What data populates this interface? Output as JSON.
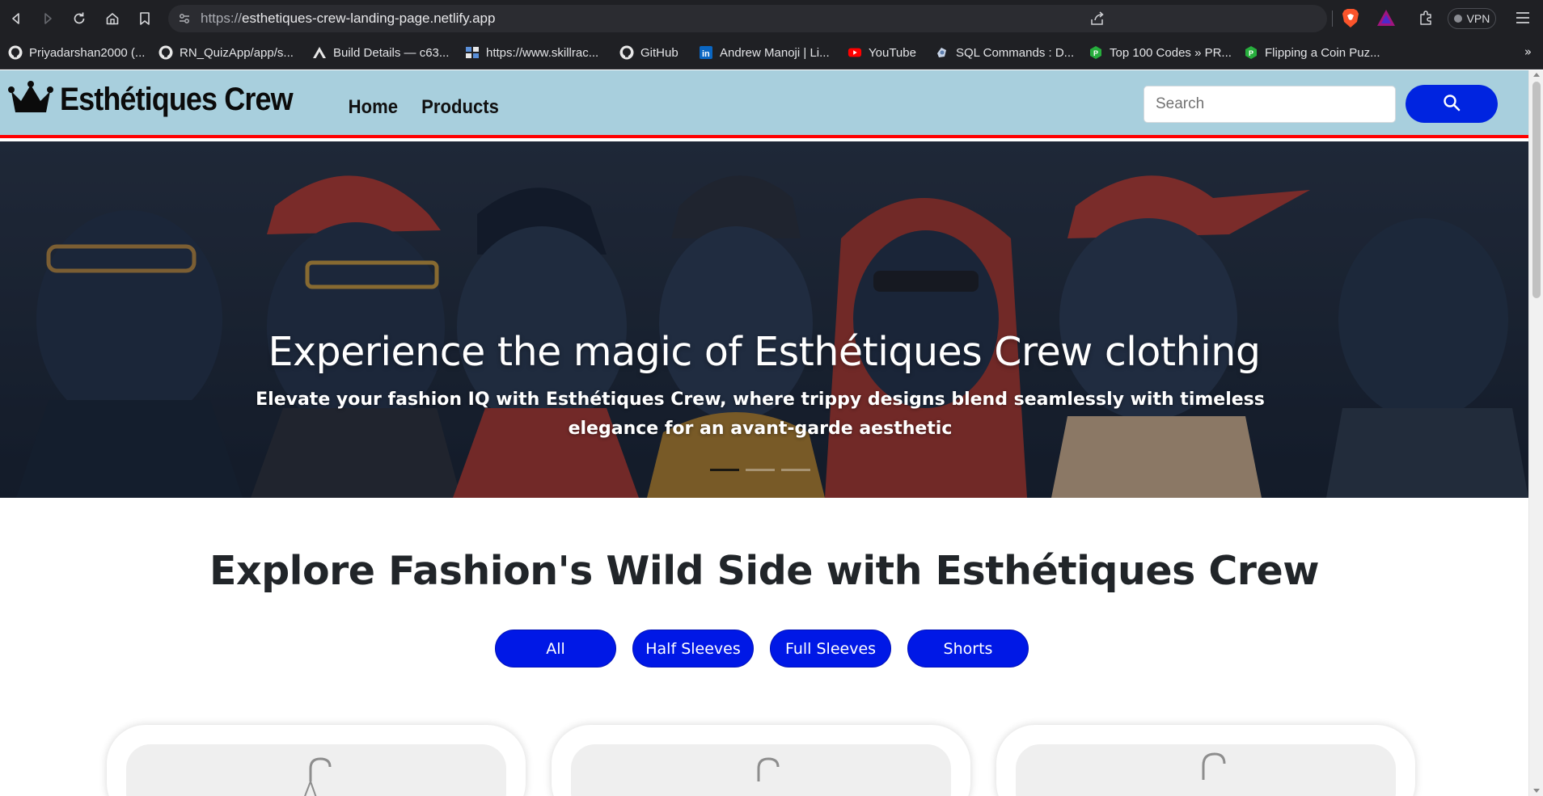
{
  "browser": {
    "url_scheme": "https://",
    "url_host": "esthetiques-crew-landing-page.netlify.app",
    "vpn_label": "VPN",
    "bookmarks": [
      {
        "label": "Priyadarshan2000 (...",
        "icon": "github-icon"
      },
      {
        "label": "RN_QuizApp/app/s...",
        "icon": "github-icon"
      },
      {
        "label": "Build Details — c63...",
        "icon": "expo-icon"
      },
      {
        "label": "https://www.skillrac...",
        "icon": "skillrack-icon"
      },
      {
        "label": "GitHub",
        "icon": "github-icon"
      },
      {
        "label": "Andrew Manoji | Li...",
        "icon": "linkedin-icon"
      },
      {
        "label": "YouTube",
        "icon": "youtube-icon"
      },
      {
        "label": "SQL Commands : D...",
        "icon": "sql-icon"
      },
      {
        "label": "Top 100 Codes » PR...",
        "icon": "prepinsta-icon"
      },
      {
        "label": "Flipping a Coin Puz...",
        "icon": "prepinsta-icon"
      }
    ],
    "more_bookmarks": "»"
  },
  "site": {
    "brand": "Esthétiques Crew",
    "nav": [
      "Home",
      "Products"
    ],
    "search_placeholder": "Search",
    "colors": {
      "header_bg": "#a8cfdd",
      "header_border": "#ff0000",
      "primary_button": "#0018e6"
    }
  },
  "hero": {
    "title": "Experience the magic of Esthétiques Crew clothing",
    "subtitle": "Elevate your fashion IQ with Esthétiques Crew, where trippy designs blend seamlessly with timeless elegance for an avant-garde aesthetic",
    "slides_total": 3,
    "active_slide": 1
  },
  "explore": {
    "title": "Explore Fashion's Wild Side with Esthétiques Crew",
    "filters": [
      "All",
      "Half Sleeves",
      "Full Sleeves",
      "Shorts"
    ]
  }
}
